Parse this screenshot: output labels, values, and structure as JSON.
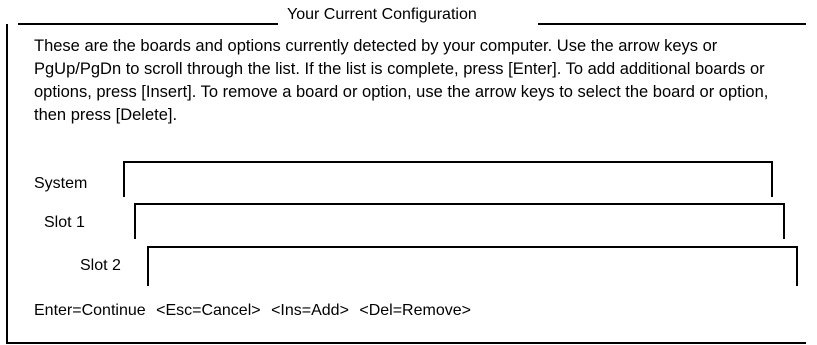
{
  "title": "Your Current Configuration",
  "instructions": "These are the boards and options currently detected by your computer.  Use the arrow keys or PgUp/PgDn to scroll through the list.  If the list is complete, press [Enter].  To add additional boards or options, press [Insert].  To remove a board or option, use the arrow keys to select the board or option, then press [Delete].",
  "rows": [
    {
      "label": "System",
      "value": ""
    },
    {
      "label": "Slot 1",
      "value": ""
    },
    {
      "label": "Slot 2",
      "value": ""
    }
  ],
  "keys": {
    "enter": "Enter=Continue",
    "esc": "<Esc=Cancel>",
    "ins": "<Ins=Add>",
    "del": "<Del=Remove>"
  }
}
